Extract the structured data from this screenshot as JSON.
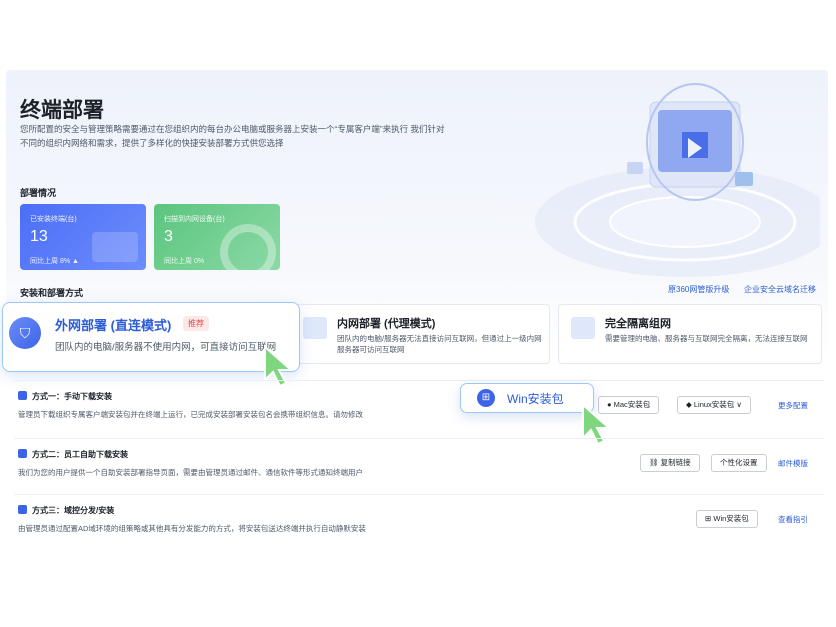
{
  "hero": {
    "title": "终端部署",
    "description": "您所配置的安全与管理策略需要通过在您组织内的每台办公电脑或服务器上安装一个“专属客户端”来执行 我们针对不同的组织内网络和需求，提供了多样化的快捷安装部署方式供您选择"
  },
  "deploy_status": {
    "label": "部署情况",
    "installed": {
      "label": "已安装终端(台)",
      "value": "13",
      "compare": "同比上周 8% ▲"
    },
    "scanned": {
      "label": "扫描到内网设备(台)",
      "value": "3",
      "compare": "同比上周 0%"
    }
  },
  "methods_section": {
    "label": "安装和部署方式",
    "link_upgrade": "原360网管版升级",
    "link_domain": "企业安全云域名迁移"
  },
  "deploy_cards": [
    {
      "title": "外网部署 (直连模式)",
      "badge": "推荐",
      "description": "团队内的电脑/服务器不使用内网，可直接访问互联网"
    },
    {
      "title": "内网部署 (代理模式)",
      "description": "团队内的电脑/服务器无法直接访问互联网，但通过上一级内网服务器可访问互联网"
    },
    {
      "title": "完全隔离组网",
      "description": "需要管理的电脑、服务器与互联网完全隔离，无法连接互联网"
    }
  ],
  "rows": [
    {
      "title": "方式一：手动下载安装",
      "description": "管理员下载组织专属客户端安装包并在终端上运行，已完成安装部署安装包名会携带组织信息。请勿修改",
      "buttons": [
        "Win安装包",
        "Mac安装包",
        "Linux安装包"
      ],
      "link": "更多配置"
    },
    {
      "title": "方式二：员工自助下载安装",
      "description": "我们为您的用户提供一个自助安装部署指导页面，需要由管理员通过邮件、通信软件等形式通知终端用户",
      "buttons": [
        "复制链接",
        "个性化设置"
      ],
      "link": "邮件模版"
    },
    {
      "title": "方式三：域控分发/安装",
      "description": "由管理员通过配置AD域环境的组策略或其他具有分发能力的方式，将安装包送达终端并执行自动静默安装",
      "buttons": [
        "Win安装包"
      ],
      "link": "查看指引"
    }
  ]
}
